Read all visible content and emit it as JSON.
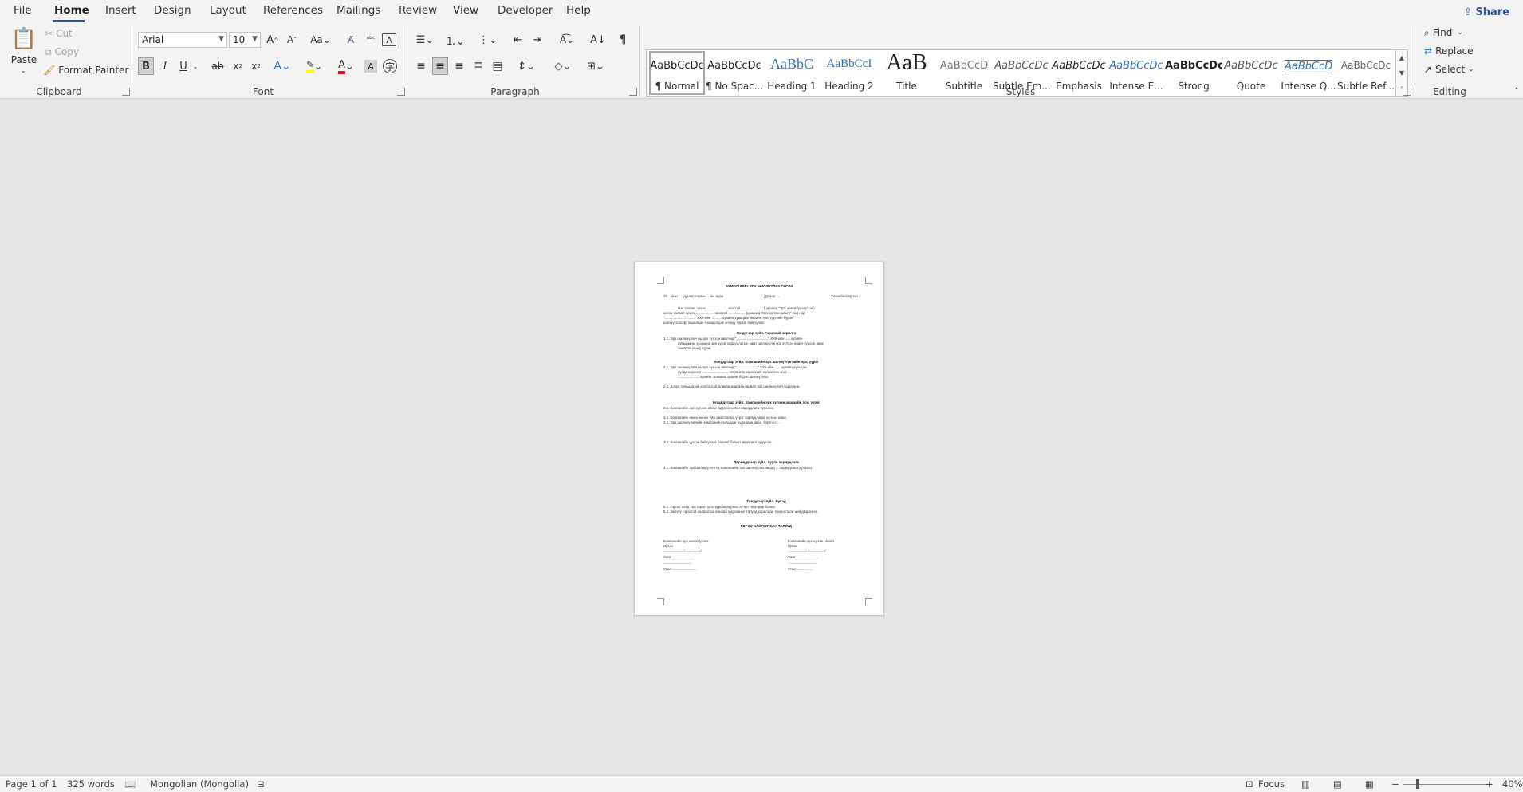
{
  "menu": {
    "tabs": [
      "File",
      "Home",
      "Insert",
      "Design",
      "Layout",
      "References",
      "Mailings",
      "Review",
      "View",
      "Developer",
      "Help"
    ],
    "active": "Home",
    "share": "Share"
  },
  "ribbon": {
    "clipboard": {
      "label": "Clipboard",
      "paste": "Paste",
      "cut": "Cut",
      "copy": "Copy",
      "format_painter": "Format Painter"
    },
    "font": {
      "label": "Font",
      "family": "Arial",
      "size": "10"
    },
    "paragraph": {
      "label": "Paragraph"
    },
    "styles": {
      "label": "Styles",
      "items": [
        {
          "preview": "AaBbCcDc",
          "name": "¶ Normal"
        },
        {
          "preview": "AaBbCcDc",
          "name": "¶ No Spac..."
        },
        {
          "preview": "AaBbC",
          "name": "Heading 1"
        },
        {
          "preview": "AaBbCcI",
          "name": "Heading 2"
        },
        {
          "preview": "AaB",
          "name": "Title"
        },
        {
          "preview": "AaBbCcD",
          "name": "Subtitle"
        },
        {
          "preview": "AaBbCcDc",
          "name": "Subtle Em..."
        },
        {
          "preview": "AaBbCcDc",
          "name": "Emphasis"
        },
        {
          "preview": "AaBbCcDc",
          "name": "Intense E..."
        },
        {
          "preview": "AaBbCcDc",
          "name": "Strong"
        },
        {
          "preview": "AaBbCcDc",
          "name": "Quote"
        },
        {
          "preview": "AaBbCcDc",
          "name": "Intense Q..."
        },
        {
          "preview": "AaBbCcDc",
          "name": "Subtle Ref..."
        }
      ]
    },
    "editing": {
      "label": "Editing",
      "find": "Find",
      "replace": "Replace",
      "select": "Select"
    }
  },
  "document": {
    "title": "КОМПАНИЙН ЭРХ ШИЛЖҮҮЛЭХ ГЭРЭЭ",
    "date_line": "20... оны .... дугаар сарын ... ны өдөр",
    "number_line": "Дугаар.....",
    "place_line": "Улаанбаатар хот",
    "lines": [
      "Нэг талаас эрхээ ..................... овогтой ...................... (цаашид \"Эрх шилжүүлэгч\" гэх)",
      "нөгөө талаас эрхээ ................... овогтой ................. (цаашид \"Эрх хүлээн авагч\" гэх) нар",
      "\"...............................\" ХХК-ийн .......... хувийн хувьцааг өөрийн эрх, үүргийн бүрэн",
      "шилжүүлэхээр харилцан тохиролцож энэхүү гэрээг байгуулав.",
      "Нэгдүгээр зүйл. Гэрээний зорилго",
      "1.1.   Эрх шилжүүлэгч нь эрх хүлээн авагчид \".................................\" ХХК-ийн ..... хувийн",
      "хувьцааны эзэмших эрх үүрэг хариуцлагын хамт шилжүүлж эрх хүлээн авагч хүлээн авах",
      "тохиролцоонд хүрэв.",
      "Хоёрдугаар зүйл. Компанийн эрх шилжүүлэгчийн эрх, үүрэг",
      "2.1.   Эрх шилжүүлэгч нь эрх хүлээн авагчид \"......................\" ХХК-ийн ...... хувийн хувьцаа,",
      "бусад хөрөнгө ........................... төгрөгийн хөрөнгийг хүлээлгэн өгөх ...",
      "...................... хувийн эзэмших эрхийг бүрэн шилжүүлнэ.",
      "2.2.   Дээрх хувьцаатай холбоотой аливаа маргаан гарвал эрх шилжүүлэгч хариуцна.",
      "Гуравдугаар зүйл. Компанийн эрх хүлээн авагчийн эрх, үүрэг",
      "3.1.   Компанийн эрх хүлээн авсан өдрөөс эхлэн хариуцлага хүлээнэ.",
      "3.2.   Компанийн өмнө өмнөх үйл ажиллагаа, үүрэг хариуцлагыг хүлээн авна.",
      "3.3.   Эрх шилжүүлэгчийн компанийн хувьцааг худалдан авах, бүртгэл, ...",
      "3.4.   Компанийн үүсгэн байгуулах баримт бичигт өөрчлөлт оруулна.",
      "Дөрөвдүгээр зүйл. Хууль хариуцлага",
      "4.1.   Компанийн эрх шилжүүлэгч нь компанийн эрх шилжүүлэх явцад ... хариуцлага хүлээнэ.",
      "Тавдугаар зүйл. Бусад",
      "5.1.   Гэрээг хоёр тал гарын үсэг зурсан өдрөөс хүчин төгөлдөр болно.",
      "5.2.   Энэхүү гэрээтэй холбоотой аливаа маргааныг талууд харилцан тохиролцож шийдвэрлэнэ.",
      "ГЭРЭЭ БАЙГУУЛСАН ТАЛУУД"
    ],
    "sign_left": [
      "Компанийн эрх шилжүүлэгч",
      "Иргэн",
      ".................... /................/",
      "Хаяг: ......................",
      ".............................",
      "Утас: ........................"
    ],
    "sign_right": [
      "Компанийн эрх хүлээн авагч",
      "Иргэн",
      ".................... /................/",
      "Хаяг: ......................",
      ".............................",
      "Утас: ................"
    ]
  },
  "status": {
    "page": "Page 1 of 1",
    "words": "325 words",
    "language": "Mongolian (Mongolia)",
    "focus": "Focus",
    "zoom": "40%"
  },
  "colors": {
    "accent": "#2b579a",
    "highlight_yellow": "#ffff00",
    "font_red": "#e81123"
  }
}
